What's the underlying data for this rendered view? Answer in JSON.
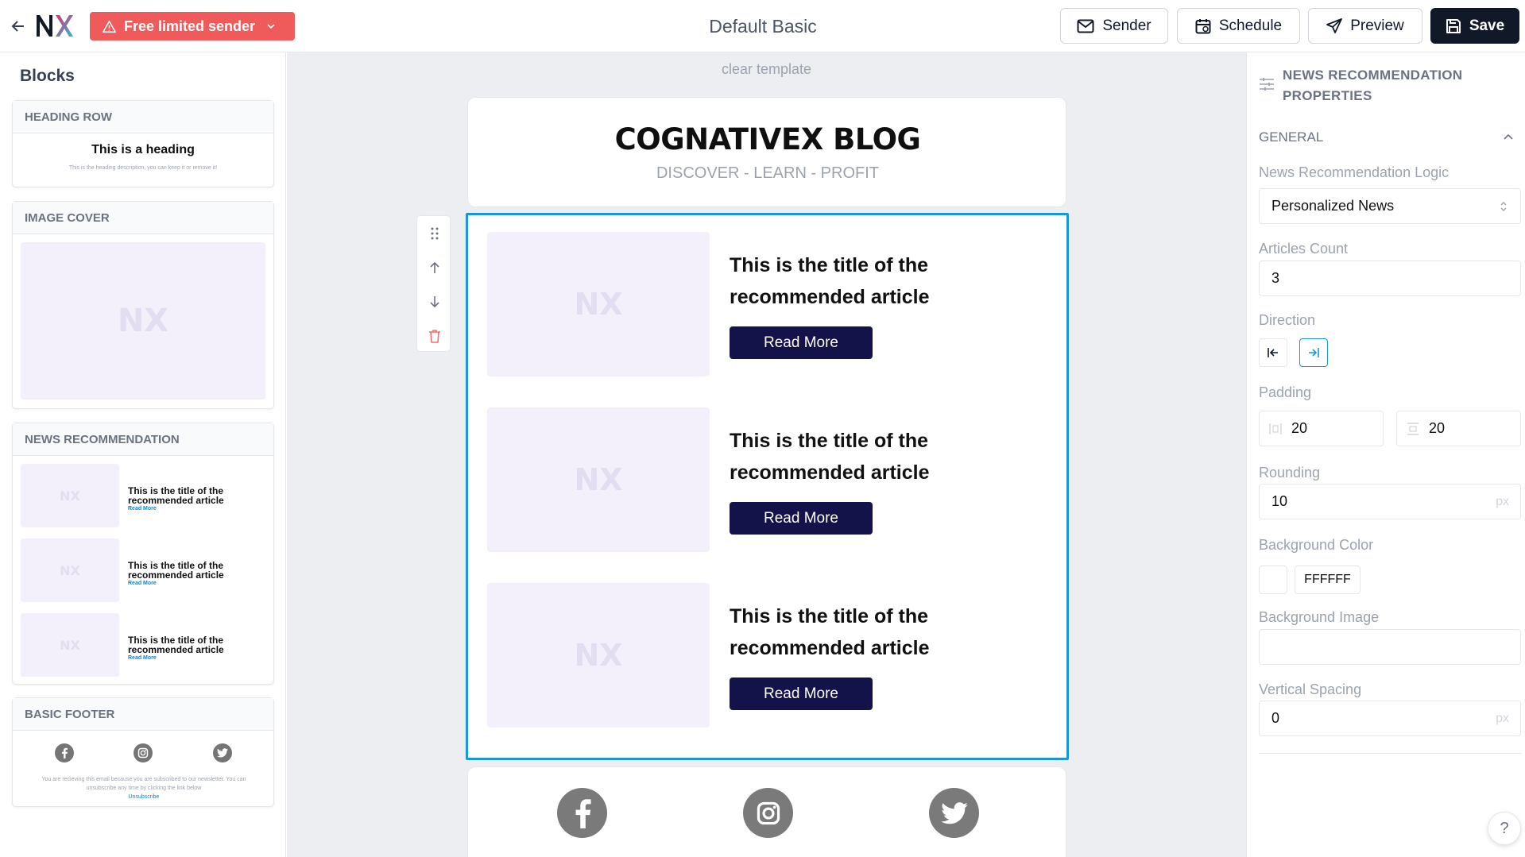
{
  "topbar": {
    "logo": "NX",
    "sender_badge": "Free limited sender",
    "title": "Default Basic",
    "buttons": {
      "sender": "Sender",
      "schedule": "Schedule",
      "preview": "Preview",
      "save": "Save"
    }
  },
  "blocks_panel": {
    "title": "Blocks",
    "heading_row": {
      "label": "HEADING ROW",
      "heading": "This is a heading",
      "description": "This is the heading description, you can keep it or remove it!"
    },
    "image_cover": {
      "label": "IMAGE COVER",
      "placeholder": "NX"
    },
    "news_recommendation": {
      "label": "NEWS RECOMMENDATION",
      "items": [
        {
          "placeholder": "NX",
          "title": "This is the title of the recommended article",
          "link": "Read More"
        },
        {
          "placeholder": "NX",
          "title": "This is the title of the recommended article",
          "link": "Read More"
        },
        {
          "placeholder": "NX",
          "title": "This is the title of the recommended article",
          "link": "Read More"
        }
      ]
    },
    "basic_footer": {
      "label": "BASIC FOOTER",
      "text": "You are recieving this email because you are subscribed to our newsletter. You can unsubscribe any time by clicking the link below",
      "unsubscribe": "Unsubscribe"
    }
  },
  "canvas": {
    "clear_template": "clear template",
    "blog_title": "COGNATIVEX BLOG",
    "blog_subtitle": "DISCOVER - LEARN - PROFIT",
    "articles": [
      {
        "placeholder": "NX",
        "title": "This is the title of the recommended article",
        "button": "Read More"
      },
      {
        "placeholder": "NX",
        "title": "This is the title of the recommended article",
        "button": "Read More"
      },
      {
        "placeholder": "NX",
        "title": "This is the title of the recommended article",
        "button": "Read More"
      }
    ]
  },
  "properties": {
    "title": "NEWS RECOMMENDATION PROPERTIES",
    "section": "GENERAL",
    "logic_label": "News Recommendation Logic",
    "logic_value": "Personalized News",
    "count_label": "Articles Count",
    "count_value": "3",
    "direction_label": "Direction",
    "padding_label": "Padding",
    "padding_h": "20",
    "padding_v": "20",
    "rounding_label": "Rounding",
    "rounding_value": "10",
    "unit": "px",
    "bgcolor_label": "Background Color",
    "bgcolor_value": "FFFFFF",
    "bgimage_label": "Background Image",
    "spacing_label": "Vertical Spacing",
    "spacing_value": "0"
  },
  "help": "?",
  "colors": {
    "accent": "#1a98d6",
    "badge": "#ef5a5a",
    "button_dark": "#13134a",
    "logo_n": "#111827",
    "logo_x_start": "#e0306b",
    "logo_x_end": "#2bb6d9"
  }
}
